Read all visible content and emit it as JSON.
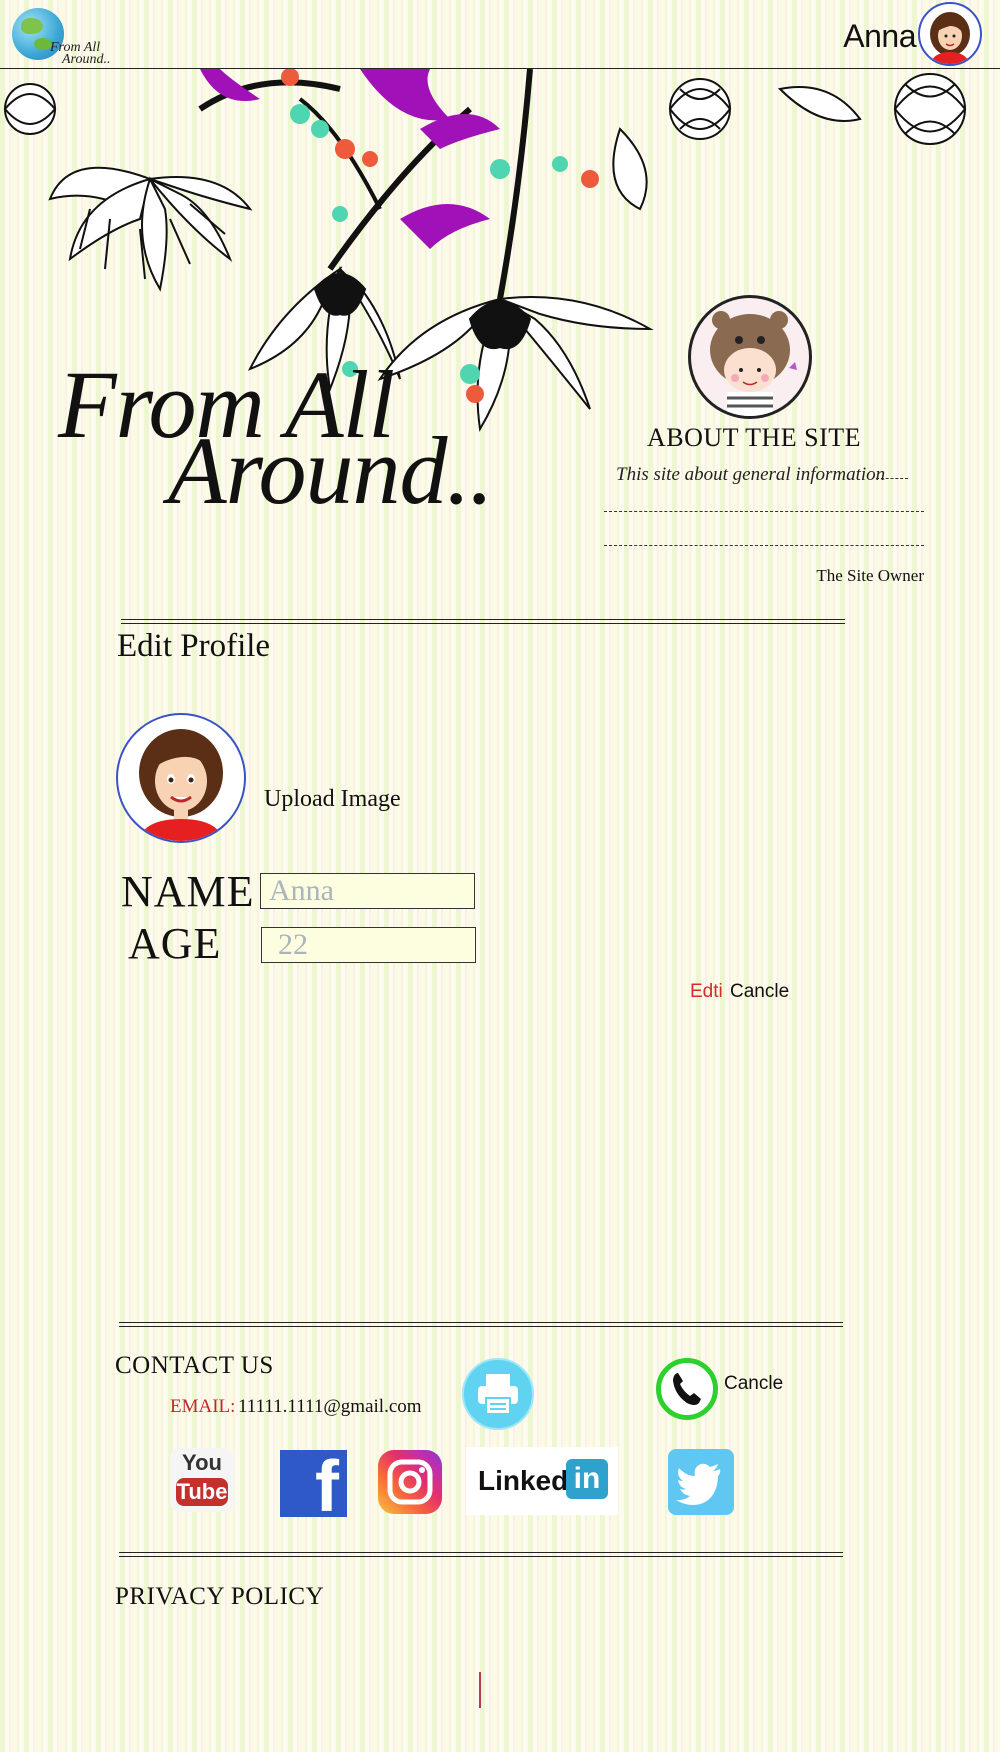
{
  "header": {
    "logo_text_line1": "From All",
    "logo_text_line2": "Around..",
    "user_name": "Anna"
  },
  "hero": {
    "title_line1": "From All",
    "title_line2": "Around.."
  },
  "about": {
    "title": "ABOUT THE SITE",
    "text": "This site about general information",
    "signature": "The Site Owner"
  },
  "edit_profile": {
    "title": "Edit Profile",
    "upload_label": "Upload Image",
    "name_label": "NAME",
    "name_placeholder": "Anna",
    "age_label": "AGE",
    "age_placeholder": "22",
    "edit_label": "Edti",
    "cancel_label": "Cancle"
  },
  "contact": {
    "title": "CONTACT US",
    "email_label": "EMAIL:",
    "email_value": "11111.1111@gmail.com",
    "phone_label": "Cancle",
    "social": {
      "youtube_line1": "You",
      "youtube_line2": "Tube",
      "facebook": "f",
      "linkedin_prefix": "Linked",
      "linkedin_suffix": "in"
    }
  },
  "privacy": {
    "title": "PRIVACY POLICY"
  },
  "colors": {
    "accent_red": "#d42a2a",
    "avatar_border": "#3a52c8",
    "input_bg": "#fdfde0",
    "phone_green": "#2ed02e",
    "print_blue": "#5fd3f0"
  },
  "icons": [
    "globe-logo-icon",
    "printer-icon",
    "phone-icon",
    "youtube-icon",
    "facebook-icon",
    "instagram-icon",
    "linkedin-icon",
    "twitter-icon"
  ]
}
